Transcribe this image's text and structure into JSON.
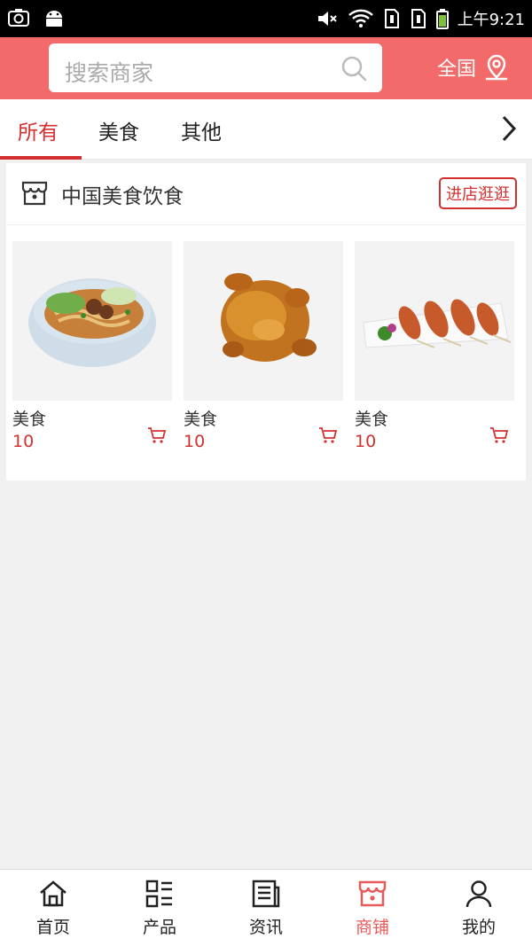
{
  "status_bar": {
    "time": "上午9:21"
  },
  "search": {
    "placeholder": "搜索商家"
  },
  "region": {
    "label": "全国"
  },
  "tabs": [
    {
      "label": "所有",
      "active": true
    },
    {
      "label": "美食",
      "active": false
    },
    {
      "label": "其他",
      "active": false
    }
  ],
  "store": {
    "name": "中国美食饮食",
    "visit_label": "进店逛逛",
    "products": [
      {
        "name": "美食",
        "price": "10",
        "image": "noodle-bowl"
      },
      {
        "name": "美食",
        "price": "10",
        "image": "roast-chicken"
      },
      {
        "name": "美食",
        "price": "10",
        "image": "grilled-skewers"
      }
    ]
  },
  "bottom_nav": [
    {
      "label": "首页",
      "icon": "home-icon",
      "active": false
    },
    {
      "label": "产品",
      "icon": "product-list-icon",
      "active": false
    },
    {
      "label": "资讯",
      "icon": "news-icon",
      "active": false
    },
    {
      "label": "商铺",
      "icon": "shop-icon",
      "active": true
    },
    {
      "label": "我的",
      "icon": "user-icon",
      "active": false
    }
  ],
  "colors": {
    "header": "#f26a6a",
    "accent": "#d32f2f",
    "nav_active": "#e85a5a"
  }
}
